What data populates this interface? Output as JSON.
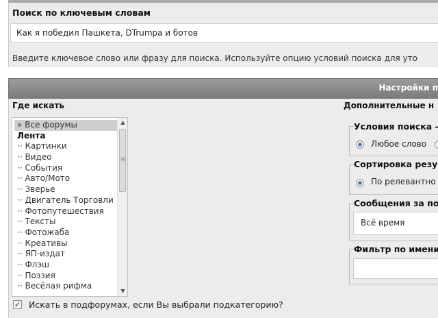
{
  "keyword_search": {
    "title": "Поиск по ключевым словам",
    "input_value": "Как я победил Пашкета, DTrumpa и ботов",
    "hint": "Введите ключевое слово или фразу для поиска. Используйте опцию условий поиска для уто"
  },
  "settings": {
    "title": "Настройки п",
    "where_label": "Где искать",
    "extra_label": "Дополнительные н"
  },
  "forum_list": {
    "items": [
      {
        "label": "» Все форумы",
        "type": "selected"
      },
      {
        "label": "Лента",
        "type": "group"
      },
      {
        "label": "·· Картинки",
        "type": "item"
      },
      {
        "label": "·· Видео",
        "type": "item"
      },
      {
        "label": "·· События",
        "type": "item"
      },
      {
        "label": "·· Авто/Мото",
        "type": "item"
      },
      {
        "label": "·· Зверье",
        "type": "item"
      },
      {
        "label": "·· Двигатель Торговли",
        "type": "item"
      },
      {
        "label": "·· Фотопутешествия",
        "type": "item"
      },
      {
        "label": "·· Тексты",
        "type": "item"
      },
      {
        "label": "·· Фотожаба",
        "type": "item"
      },
      {
        "label": "·· Креативы",
        "type": "item"
      },
      {
        "label": "·· ЯП-издат",
        "type": "item"
      },
      {
        "label": "·· Флэш",
        "type": "item"
      },
      {
        "label": "·· Поэзия",
        "type": "item"
      },
      {
        "label": "·· Весёлая рифма",
        "type": "item"
      }
    ],
    "subforums_checkbox": {
      "label": "Искать в подфорумах, если Вы выбрали подкатегорию?",
      "checked": true
    }
  },
  "search_conditions": {
    "legend": "Условия поиска",
    "selected_option": "Любое слово"
  },
  "sort_results": {
    "legend": "Сортировка резу",
    "selected_option": "По релевантно"
  },
  "messages_period": {
    "legend": "Сообщения за по",
    "selected_value": "Всё время"
  },
  "name_filter": {
    "legend": "Фильтр по имени",
    "value": ""
  },
  "colors": {
    "panel_bg": "#ececec",
    "header_gradient_top": "#9b9b9b",
    "header_gradient_bottom": "#7c7c7c",
    "radio_accent": "#4d6f95"
  }
}
